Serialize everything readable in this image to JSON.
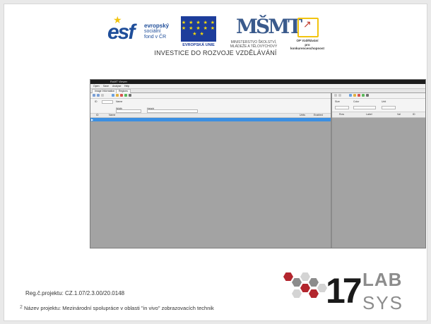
{
  "logos": {
    "esf_mark": "esf",
    "esf_text_line1": "evropský",
    "esf_text_line2": "sociální",
    "esf_text_line3": "fond v ČR",
    "eu_label": "EVROPSKÁ UNIE",
    "eu_stars": "★ ★ ★ ★ ★ ★ ★ ★ ★ ★ ★ ★",
    "msmt_mark": "MŠMT",
    "msmt_label_line1": "MINISTERSTVO ŠKOLSTVÍ,",
    "msmt_label_line2": "MLÁDEŽE A TĚLOVÝCHOVY",
    "op_label_line1": "OP Vzdělávání",
    "op_label_line2": "pro konkurenceschopnost",
    "tagline": "INVESTICE DO ROZVOJE VZDĚLÁVÁNÍ"
  },
  "app": {
    "title": "RoMT Viewer",
    "menu": [
      "Open",
      "Save",
      "Analyse",
      "Help"
    ],
    "tabs": [
      "Image Information",
      "Regions"
    ],
    "form_labels": [
      "ID",
      "Name",
      "Width",
      "Height"
    ],
    "grid_columns": [
      "ID",
      "Name",
      "Units",
      "Enabled"
    ],
    "row_marker": "▶",
    "right_form_labels": [
      "Size",
      "Color",
      "Unit"
    ],
    "right_grid_columns": [
      "Row",
      "Label",
      "Val",
      "ID"
    ]
  },
  "footer": {
    "reg": "Reg.č.projektu: CZ.1.07/2.3.00/20.0148",
    "page_number": "2",
    "project_name": "Název projektu: Mezinárodní spolupráce v oblasti \"in vivo\" zobrazovacích technik",
    "lab_word": "LAB",
    "sys_word": "SYS",
    "lab_number": "17"
  },
  "colors": {
    "accent_blue": "#3b8fe2",
    "esf_blue": "#1f4e9a",
    "eu_blue": "#1d3d9b",
    "logo_red": "#b3262e",
    "logo_grey": "#8c8c8c"
  }
}
